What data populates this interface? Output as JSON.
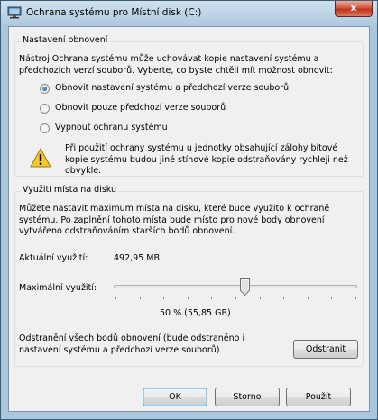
{
  "window": {
    "title": "Ochrana systému pro Místní disk (C:)",
    "close_label": "x"
  },
  "restore": {
    "group_title": "Nastavení obnovení",
    "description": "Nástroj Ochrana systému může uchovávat kopie nastavení systému a předchozích verzí souborů. Vyberte, co byste chtěli mít možnost obnovit:",
    "options": [
      {
        "label": "Obnovit nastavení systému a předchozí verze souborů",
        "checked": true
      },
      {
        "label": "Obnovit pouze předchozí verze souborů",
        "checked": false
      },
      {
        "label": "Vypnout ochranu systému",
        "checked": false
      }
    ],
    "warning": "Při použití ochrany systému u jednotky obsahující zálohy bitové kopie systému budou jiné stínové kopie odstraňovány rychleji než obvykle."
  },
  "disk": {
    "group_title": "Využití místa na disku",
    "description": "Můžete nastavit maximum místa na disku, které bude využito k ochraně systému. Po zaplnění tohoto místa bude místo pro nové body obnovení vytvářeno odstraňováním starších bodů obnovení.",
    "current_label": "Aktuální využití:",
    "current_value": "492,95 MB",
    "max_label": "Maximální využití:",
    "slider_percent": 50,
    "slider_readout": "50 % (55,85 GB)",
    "delete_text": "Odstranění všech bodů obnovení (bude odstraněno i nastavení systému a předchozí verze souborů)",
    "delete_button": "Odstranit"
  },
  "buttons": {
    "ok": "OK",
    "cancel": "Storno",
    "apply": "Použít"
  },
  "colors": {
    "accent": "#3c7fb1",
    "close": "#c0301a"
  }
}
